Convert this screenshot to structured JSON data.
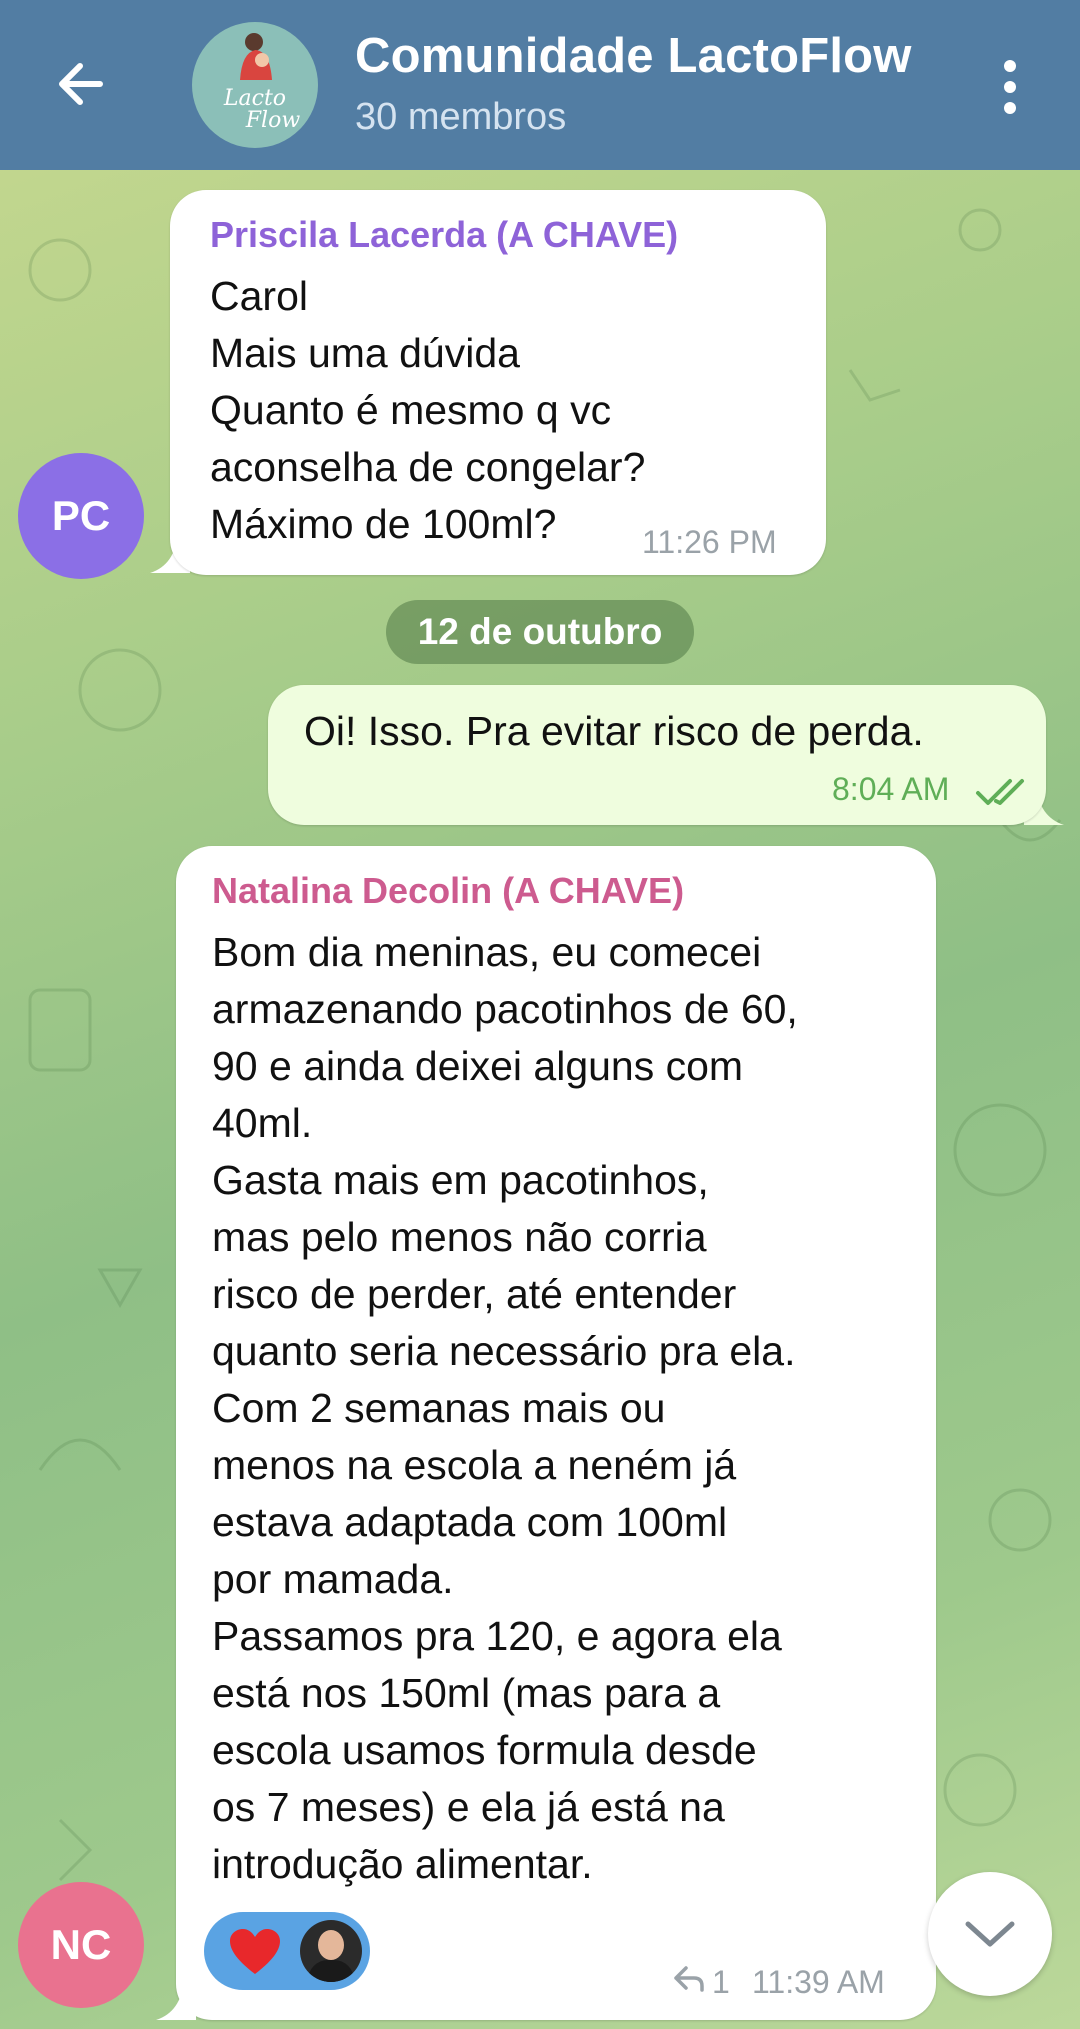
{
  "header": {
    "title": "Comunidade LactoFlow",
    "subtitle": "30 membros",
    "logo_line1": "Lacto",
    "logo_line2": "Flow"
  },
  "messages": [
    {
      "sender": "Priscila Lacerda (A CHAVE)",
      "sender_color": "#8e63d8",
      "avatar_initials": "PC",
      "text": "Carol\nMais uma dúvida\nQuanto é mesmo q vc\naconselha de congelar?\nMáximo de 100ml?",
      "time": "11:26 PM"
    },
    {
      "date_separator": "12 de outubro"
    },
    {
      "outgoing": true,
      "text": "Oi! Isso. Pra evitar risco de perda.",
      "time": "8:04 AM"
    },
    {
      "sender": "Natalina Decolin (A CHAVE)",
      "sender_color": "#cd5b8f",
      "avatar_initials": "NC",
      "text": "Bom dia meninas, eu comecei\narmazenando pacotinhos de 60,\n90 e ainda deixei alguns com\n40ml.\nGasta mais em pacotinhos,\nmas pelo menos não corria\nrisco de perder, até entender\nquanto seria necessário pra ela.\nCom 2 semanas mais ou\nmenos na escola a neném já\nestava adaptada com 100ml\npor mamada.\nPassamos pra 120, e agora ela\nestá nos 150ml (mas para a\nescola usamos formula desde\nos 7 meses) e ela já está na\nintrodução alimentar.",
      "reply_count": "1",
      "time": "11:39 AM"
    }
  ],
  "colors": {
    "header": "#527da3",
    "avatar_pc": "#8b6fe6",
    "avatar_nc": "#e9728f",
    "outgoing_bubble": "#effdde",
    "check_green": "#5fae57"
  }
}
